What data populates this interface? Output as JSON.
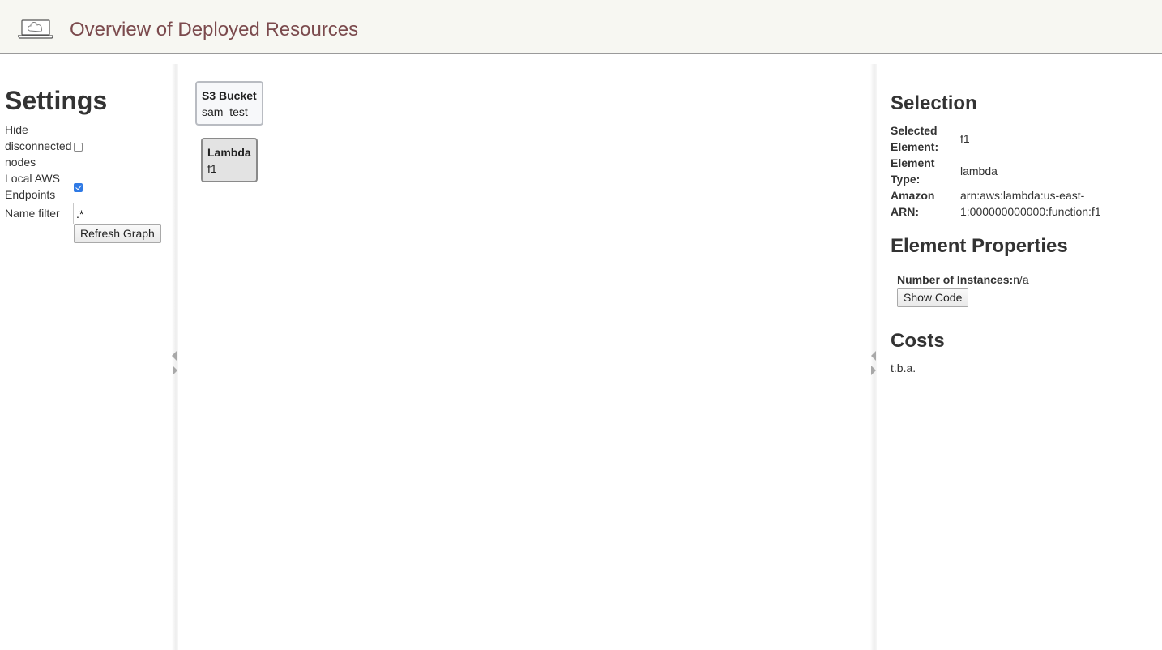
{
  "header": {
    "title": "Overview of Deployed Resources",
    "logo_icon": "laptop-cloud-icon",
    "title_color": "#7b4a4d"
  },
  "settings": {
    "title": "Settings",
    "hide_disconnected": {
      "label_lines": [
        "Hide",
        "disconnected",
        "nodes"
      ],
      "checked": false
    },
    "local_aws": {
      "label_lines": [
        "Local AWS",
        "Endpoints"
      ],
      "checked": true
    },
    "name_filter": {
      "label": "Name filter",
      "value": ".*"
    },
    "refresh_label": "Refresh Graph"
  },
  "graph": {
    "nodes": [
      {
        "type": "S3 Bucket",
        "name": "sam_test"
      },
      {
        "type": "Lambda",
        "name": "f1"
      }
    ]
  },
  "selection": {
    "title": "Selection",
    "selected_element_label": [
      "Selected",
      "Element:"
    ],
    "selected_element_value": "f1",
    "element_type_label": [
      "Element",
      "Type:"
    ],
    "element_type_value": "lambda",
    "arn_label": [
      "Amazon",
      "ARN:"
    ],
    "arn_value_lines": [
      "arn:aws:lambda:us-east-",
      "1:000000000000:function:f1"
    ]
  },
  "properties": {
    "title": "Element Properties",
    "instances_label": "Number of Instances:",
    "instances_value": "n/a",
    "show_code_label": "Show Code"
  },
  "costs": {
    "title": "Costs",
    "text": "t.b.a."
  }
}
